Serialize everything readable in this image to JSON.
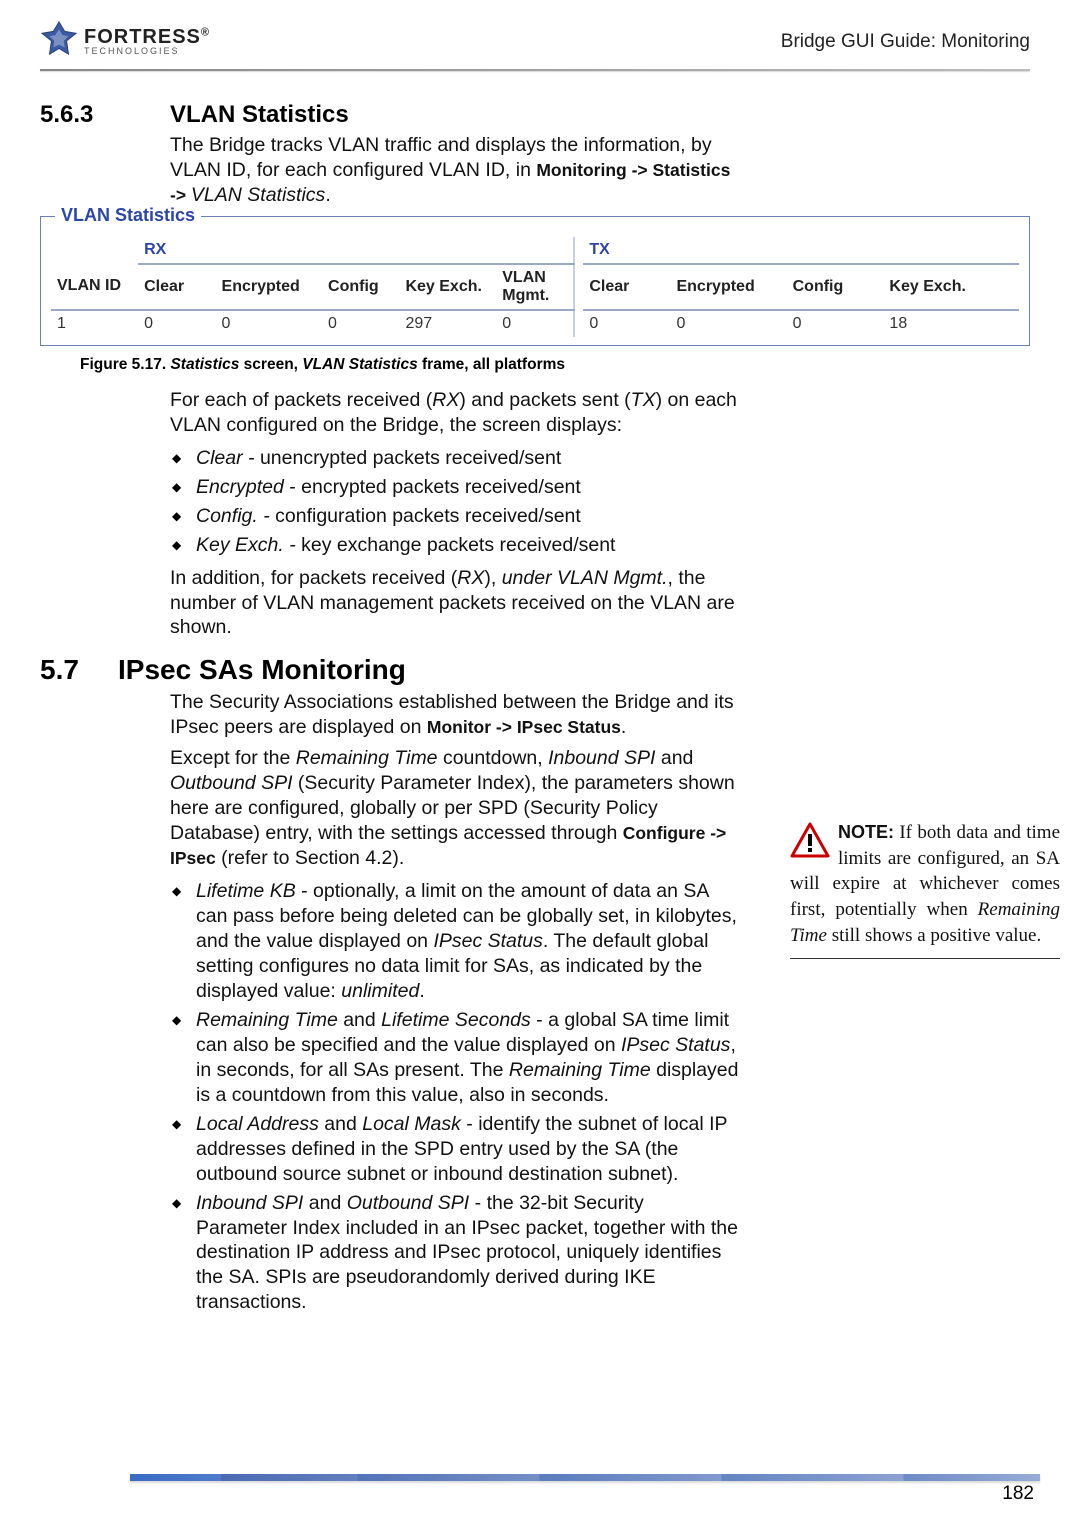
{
  "header": {
    "logo_main": "FORTRESS",
    "logo_reg": "®",
    "logo_sub": "TECHNOLOGIES",
    "right": "Bridge GUI Guide: Monitoring"
  },
  "section_563": {
    "number": "5.6.3",
    "title": "VLAN Statistics",
    "intro_a": "The Bridge tracks VLAN traffic and displays the information, by VLAN ID, for each configured VLAN ID, in ",
    "intro_b_strong": "Monitoring -> Statistics -> ",
    "intro_c_italic": "VLAN Statistics",
    "intro_d": "."
  },
  "vlan_stats": {
    "legend": "VLAN Statistics",
    "rx_label": "RX",
    "tx_label": "TX",
    "cols": {
      "vlan_id": "VLAN ID",
      "clear": "Clear",
      "encrypted": "Encrypted",
      "config": "Config",
      "key_exch": "Key Exch.",
      "vlan_mgmt_l1": "VLAN",
      "vlan_mgmt_l2": "Mgmt."
    },
    "row": {
      "vlan_id": "1",
      "rx_clear": "0",
      "rx_encrypted": "0",
      "rx_config": "0",
      "rx_key_exch": "297",
      "rx_vlan_mgmt": "0",
      "tx_clear": "0",
      "tx_encrypted": "0",
      "tx_config": "0",
      "tx_key_exch": "18"
    }
  },
  "figure_caption": {
    "prefix": "Figure 5.17. ",
    "i1": "Statistics",
    "mid1": " screen, ",
    "i2": "VLAN Statistics",
    "suffix": " frame, all platforms"
  },
  "body_563": {
    "p1_a": "For each of packets received (",
    "p1_rx": "RX",
    "p1_b": ") and packets sent (",
    "p1_tx": "TX",
    "p1_c": ") on each VLAN configured on the Bridge, the screen displays:",
    "bullets": [
      {
        "term": "Clear - ",
        "rest": "unencrypted packets received/sent"
      },
      {
        "term": "Encrypted",
        "rest": " - encrypted packets received/sent"
      },
      {
        "term": "Config. - ",
        "rest": "configuration packets received/sent"
      },
      {
        "term": "Key Exch. - ",
        "rest": "key exchange packets received/sent"
      }
    ],
    "p2_a": "In addition, for packets received (",
    "p2_rx": "RX",
    "p2_b": "), ",
    "p2_under": "under VLAN Mgmt.",
    "p2_c": ", the number of VLAN management packets received on the VLAN are shown."
  },
  "section_57": {
    "number": "5.7",
    "title": "IPsec SAs Monitoring"
  },
  "body_57": {
    "p1_a": "The Security Associations established between the Bridge and its IPsec peers are displayed on ",
    "p1_b_strong": "Monitor -> IPsec Status",
    "p1_c": ".",
    "p2_a": "Except for the ",
    "p2_i1": "Remaining Time",
    "p2_b": " countdown, ",
    "p2_i2": "Inbound SPI",
    "p2_c": " and ",
    "p2_i3": "Outbound SPI",
    "p2_d": " (Security Parameter Index), the parameters shown here are configured, globally or per SPD (Security Policy Database) entry, with the settings accessed through ",
    "p2_e_strong": "Configure -> IPsec",
    "p2_f": " (refer to Section 4.2).",
    "bullets": [
      {
        "t1": "Lifetime KB",
        "rest_a": " - optionally, a limit on the amount of data an SA can pass before being deleted can be globally set, in kilobytes, and the value displayed on ",
        "t2": "IPsec Status",
        "rest_b": ". The default global setting configures no data limit for SAs, as indicated by the displayed value: ",
        "t3": "unlimited",
        "rest_c": "."
      },
      {
        "t1": "Remaining Time",
        "rest_a": " and ",
        "t2": "Lifetime Seconds",
        "rest_b": " - a global SA time limit can also be specified and the value displayed on ",
        "t3": "IPsec Status",
        "rest_c": ", in seconds, for all SAs present. The ",
        "t4": "Remaining Time",
        "rest_d": " displayed is a countdown from this value, also in seconds."
      },
      {
        "t1": "Local Address",
        "rest_a": " and ",
        "t2": "Local Mask",
        "rest_b": " - identify the subnet of local IP addresses defined in the SPD entry used by the SA (the outbound source subnet or inbound destination subnet)."
      },
      {
        "t1": "Inbound SPI",
        "rest_a": " and ",
        "t2": "Outbound SPI",
        "rest_b": " - the 32-bit Security Parameter Index included in an IPsec packet, together with the destination IP address and IPsec protocol, uniquely identifies the SA. SPIs are pseudorandomly derived during IKE transactions."
      }
    ]
  },
  "note": {
    "label": "NOTE:",
    "text_a": " If both data and time limits are configured, an SA will expire at whichever comes first, potentially when ",
    "text_i": "Remaining Time",
    "text_b": " still shows a positive value."
  },
  "page_number": "182",
  "chart_data": {
    "type": "table",
    "title": "VLAN Statistics",
    "columns": [
      "VLAN ID",
      "RX Clear",
      "RX Encrypted",
      "RX Config",
      "RX Key Exch.",
      "RX VLAN Mgmt.",
      "TX Clear",
      "TX Encrypted",
      "TX Config",
      "TX Key Exch."
    ],
    "rows": [
      [
        "1",
        0,
        0,
        0,
        297,
        0,
        0,
        0,
        0,
        18
      ]
    ]
  }
}
